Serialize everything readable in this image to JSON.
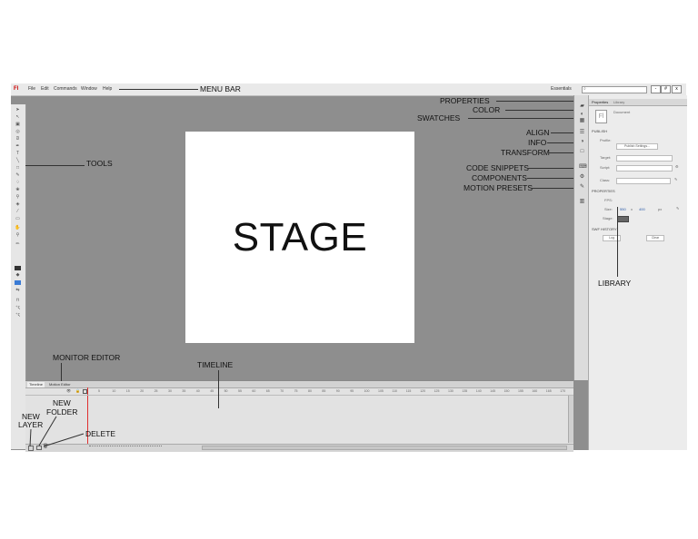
{
  "app": {
    "logo": "Fl",
    "menus": [
      "File",
      "Edit",
      "Commands",
      "Window",
      "Help"
    ],
    "workspace": "Essentials",
    "search_placeholder": "",
    "window_controls": [
      "-",
      "#",
      "x"
    ]
  },
  "stage": {
    "label": "STAGE"
  },
  "timeline": {
    "tabs": [
      "Timeline",
      "Motion Editor"
    ],
    "frame_numbers": [
      "5",
      "10",
      "15",
      "20",
      "25",
      "30",
      "35",
      "40",
      "45",
      "50",
      "55",
      "60",
      "65",
      "70",
      "75",
      "80",
      "85",
      "90",
      "95",
      "100",
      "105",
      "110",
      "115",
      "120",
      "125",
      "130",
      "135",
      "140",
      "145",
      "150",
      "155",
      "160",
      "165",
      "170"
    ]
  },
  "properties_panel": {
    "tabs": [
      "Properties",
      "Library"
    ],
    "doc_title": "Document",
    "publish_header": "PUBLISH",
    "profile_label": "Profile:",
    "publish_settings_button": "Publish Settings...",
    "target_label": "Target:",
    "script_label": "Script:",
    "class_label": "Class:",
    "properties_header": "PROPERTIES",
    "fps_label": "FPS:",
    "size_label": "Size:",
    "size_w": "550",
    "size_x": "x",
    "size_h": "400",
    "size_unit": "px",
    "stage_label": "Stage:",
    "swf_header": "SWF HISTORY",
    "log_button": "Log",
    "clear_button": "Clear"
  },
  "annotations": {
    "menu_bar": "MENU BAR",
    "tools": "TOOLS",
    "properties": "PROPERTIES",
    "color": "COLOR",
    "swatches": "SWATCHES",
    "align": "ALIGN",
    "info": "INFO",
    "transform": "TRANSFORM",
    "code_snippets": "CODE SNIPPETS",
    "components": "COMPONENTS",
    "motion_presets": "MOTION PRESETS",
    "library": "LIBRARY",
    "monitor_editor": "MONITOR EDITOR",
    "timeline": "TIMELINE",
    "new_layer_1": "NEW",
    "new_layer_2": "LAYER",
    "new_folder_1": "NEW",
    "new_folder_2": "FOLDER",
    "delete": "DELETE"
  },
  "colors": {
    "stage_bg": "#ffffff",
    "workspace": "#8e8e8e",
    "playhead": "#e03030",
    "fill_swatch": "#3a7bd5"
  }
}
